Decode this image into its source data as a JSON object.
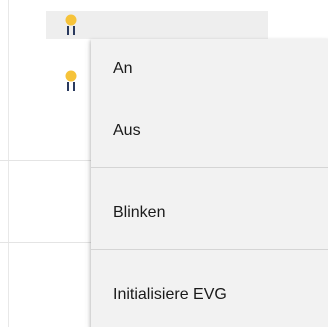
{
  "tree": {
    "rows": [
      {
        "icon": "lamp-icon",
        "selected": true
      },
      {
        "icon": "lamp-icon",
        "selected": false
      }
    ]
  },
  "context_menu": {
    "items": [
      {
        "label": "An"
      },
      {
        "label": "Aus"
      },
      {
        "label": "Blinken"
      },
      {
        "label": "Initialisiere EVG"
      }
    ]
  },
  "colors": {
    "lamp_bulb": "#f6c33a",
    "lamp_base": "#2a3a5e",
    "selection": "#eeeeee",
    "menu_bg": "#f2f2f2"
  }
}
